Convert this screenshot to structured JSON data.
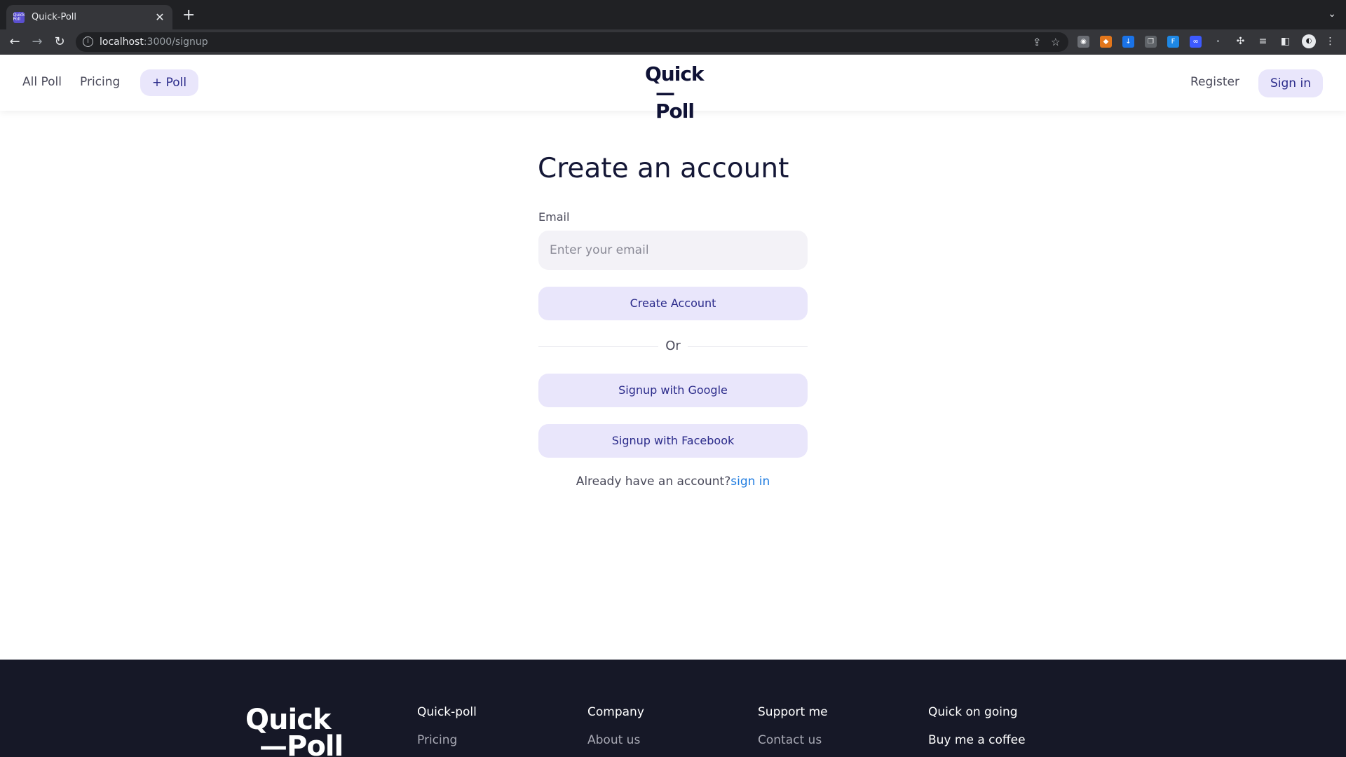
{
  "browser": {
    "tab_title": "Quick-Poll",
    "favicon_text": "Quick Poll",
    "url_host": "localhost",
    "url_path": ":3000/signup",
    "icons": [
      "back-arrow-icon",
      "forward-arrow-icon",
      "reload-icon",
      "site-info-icon",
      "share-icon",
      "bookmark-star-icon",
      "extensions-puzzle-icon",
      "reading-list-icon",
      "side-panel-icon",
      "profile-avatar-icon",
      "kebab-menu-icon"
    ]
  },
  "header": {
    "nav": [
      "All Poll",
      "Pricing"
    ],
    "poll_button": "+ Poll",
    "logo_line1": "Quick",
    "logo_line2": "—Poll",
    "register": "Register",
    "sign_in": "Sign in"
  },
  "form": {
    "title": "Create an account",
    "email_label": "Email",
    "email_placeholder": "Enter your email",
    "email_value": "",
    "create_button": "Create Account",
    "divider_text": "Or",
    "google_button": "Signup with Google",
    "facebook_button": "Signup with Facebook",
    "already_text": "Already have an account?",
    "signin_link": "sign in"
  },
  "footer": {
    "logo_line1": "Quick",
    "logo_line2": "—Poll",
    "columns": [
      {
        "title": "Quick-poll",
        "link": "Pricing"
      },
      {
        "title": "Company",
        "link": "About us"
      },
      {
        "title": "Support me",
        "link": "Contact us"
      },
      {
        "title": "Quick on going",
        "link": "Buy me a coffee"
      }
    ]
  },
  "colors": {
    "accent_bg": "#e9e6fb",
    "accent_text": "#2a2a8a",
    "link": "#1e7be0",
    "footer_bg": "#161827"
  }
}
